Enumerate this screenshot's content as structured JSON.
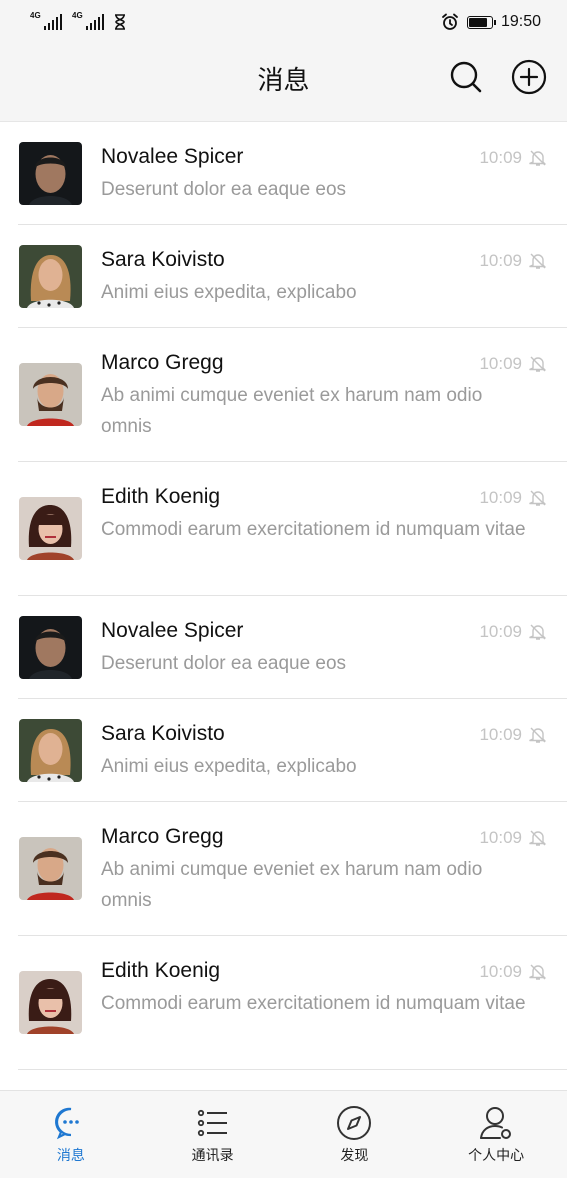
{
  "status_bar": {
    "network1": "4G",
    "network2": "4G",
    "time": "19:50"
  },
  "header": {
    "title": "消息"
  },
  "messages": [
    {
      "name": "Novalee Spicer",
      "preview": "Deserunt dolor ea eaque eos",
      "time": "10:09",
      "avatar": "man-dark-hair",
      "muted": true
    },
    {
      "name": "Sara Koivisto",
      "preview": "Animi eius expedita, explicabo",
      "time": "10:09",
      "avatar": "woman-blonde",
      "muted": true
    },
    {
      "name": "Marco Gregg",
      "preview": "Ab animi cumque eveniet ex harum nam odio omnis",
      "time": "10:09",
      "avatar": "man-beard",
      "muted": true
    },
    {
      "name": "Edith Koenig",
      "preview": "Commodi earum exercitationem id numquam vitae",
      "time": "10:09",
      "avatar": "woman-dark-bangs",
      "muted": true
    },
    {
      "name": "Novalee Spicer",
      "preview": "Deserunt dolor ea eaque eos",
      "time": "10:09",
      "avatar": "man-dark-hair",
      "muted": true
    },
    {
      "name": "Sara Koivisto",
      "preview": "Animi eius expedita, explicabo",
      "time": "10:09",
      "avatar": "woman-blonde",
      "muted": true
    },
    {
      "name": "Marco Gregg",
      "preview": "Ab animi cumque eveniet ex harum nam odio omnis",
      "time": "10:09",
      "avatar": "man-beard",
      "muted": true
    },
    {
      "name": "Edith Koenig",
      "preview": "Commodi earum exercitationem id numquam vitae",
      "time": "10:09",
      "avatar": "woman-dark-bangs",
      "muted": true
    }
  ],
  "tabs": [
    {
      "label": "消息",
      "icon": "chat-bubble-icon",
      "active": true
    },
    {
      "label": "通讯录",
      "icon": "contacts-list-icon",
      "active": false
    },
    {
      "label": "发现",
      "icon": "compass-icon",
      "active": false
    },
    {
      "label": "个人中心",
      "icon": "person-icon",
      "active": false
    }
  ],
  "colors": {
    "accent": "#1f78d1",
    "bar_background": "#f5f5f5",
    "secondary_text": "#9a9a9a",
    "time_text": "#c4c4c4"
  }
}
